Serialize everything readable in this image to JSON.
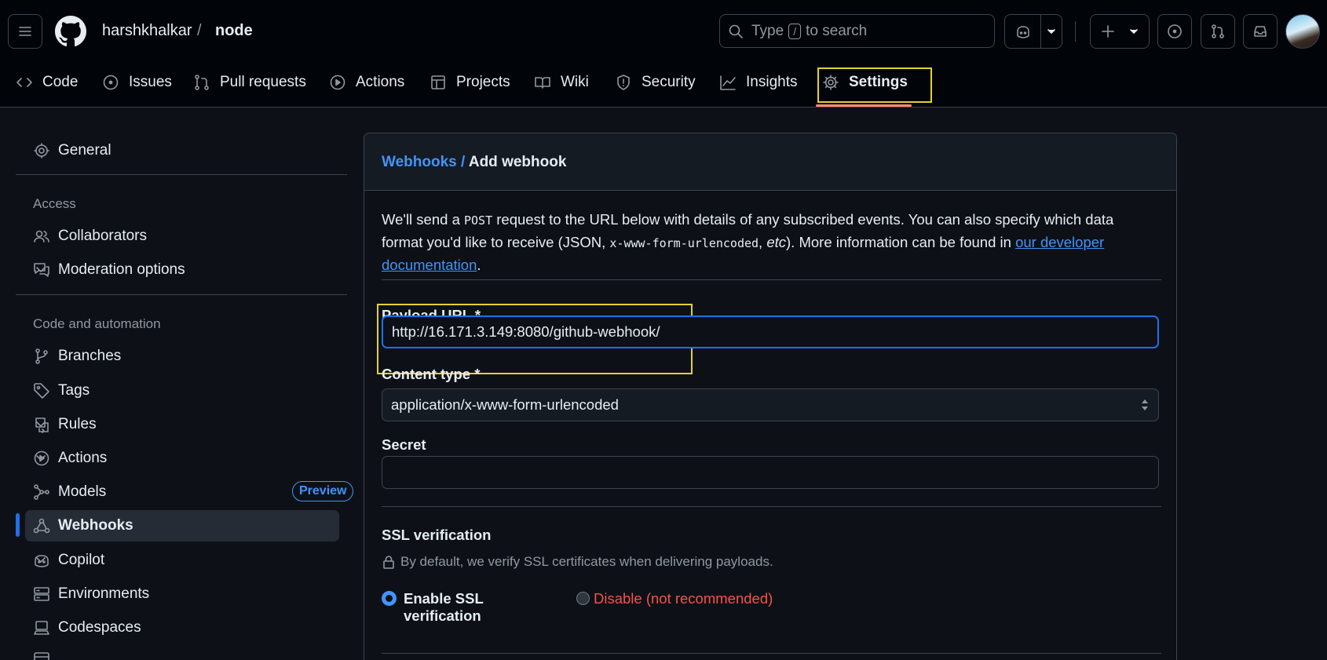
{
  "header": {
    "owner": "harshkhalkar",
    "separator": "/",
    "repo": "node",
    "search": {
      "prefix": "Type",
      "key": "/",
      "suffix": "to search"
    }
  },
  "tabs": [
    {
      "label": "Code",
      "icon": "code-icon"
    },
    {
      "label": "Issues",
      "icon": "issue-icon"
    },
    {
      "label": "Pull requests",
      "icon": "pull-request-icon"
    },
    {
      "label": "Actions",
      "icon": "play-icon"
    },
    {
      "label": "Projects",
      "icon": "table-icon"
    },
    {
      "label": "Wiki",
      "icon": "book-icon"
    },
    {
      "label": "Security",
      "icon": "shield-icon"
    },
    {
      "label": "Insights",
      "icon": "graph-icon"
    },
    {
      "label": "Settings",
      "icon": "gear-icon",
      "selected": true
    }
  ],
  "sidebar": {
    "general": "General",
    "access_heading": "Access",
    "collaborators": "Collaborators",
    "moderation": "Moderation options",
    "code_heading": "Code and automation",
    "branches": "Branches",
    "tags": "Tags",
    "rules": "Rules",
    "actions": "Actions",
    "models": "Models",
    "models_badge": "Preview",
    "webhooks": "Webhooks",
    "copilot": "Copilot",
    "environments": "Environments",
    "codespaces": "Codespaces"
  },
  "main": {
    "breadcrumb_link": "Webhooks",
    "breadcrumb_sep": "/",
    "breadcrumb_current": "Add webhook",
    "intro_1": "We'll send a",
    "intro_post": "POST",
    "intro_2": "request to the URL below with details of any subscribed events. You can also specify which data format you'd like to receive (JSON,",
    "intro_code": "x-www-form-urlencoded",
    "intro_3": ",",
    "intro_etc": "etc",
    "intro_4": "). More information can be found in",
    "intro_link": "our developer documentation",
    "intro_5": ".",
    "payload_label": "Payload URL *",
    "payload_value": "http://16.171.3.149:8080/github-webhook/",
    "content_type_label": "Content type *",
    "content_type_value": "application/x-www-form-urlencoded",
    "secret_label": "Secret",
    "secret_value": "",
    "ssl_heading": "SSL verification",
    "ssl_note": "By default, we verify SSL certificates when delivering payloads.",
    "ssl_enable": "Enable SSL verification",
    "ssl_disable": "Disable (not recommended)",
    "ssl_selected": "enable"
  },
  "colors": {
    "accent": "#4493f8",
    "highlight": "#e3d12f",
    "danger": "#f85149"
  }
}
